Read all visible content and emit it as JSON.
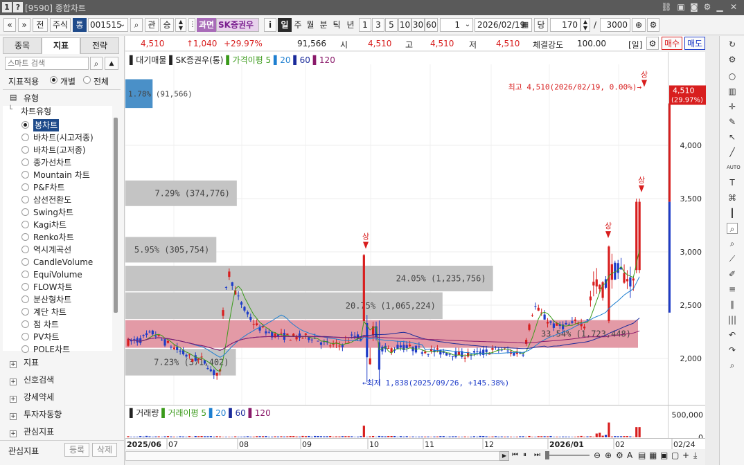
{
  "window": {
    "title": "[9590] 종합차트",
    "win_buttons": [
      "1",
      "?"
    ]
  },
  "toolbar": {
    "nav_prev": "«",
    "nav_down": "»",
    "btn_prev": "전",
    "market": "주식",
    "code_toggle": "통",
    "code": "001515",
    "btn_gwan": "관",
    "btn_sung": "승",
    "badge": "과면",
    "name": "SK증권우",
    "info": "i",
    "periods": [
      "일",
      "주",
      "월",
      "분",
      "틱",
      "년"
    ],
    "active_period": "일",
    "intervals": [
      "1",
      "3",
      "5",
      "10",
      "30",
      "60"
    ],
    "count_field": "1",
    "date": "2026/02/19",
    "btn_dang": "당",
    "view_count": "170",
    "slash": "/",
    "total_count": "3000"
  },
  "left_panel": {
    "tabs": [
      "종목",
      "지표",
      "전략"
    ],
    "active_tab": "지표",
    "search_placeholder": "스마트 검색",
    "apply_label": "지표적용",
    "apply_individual": "개별",
    "apply_all": "전체",
    "section_type": "유형",
    "section_chart_type": "차트유형",
    "chart_types": [
      "봉차트",
      "바차트(시고저종)",
      "바차트(고저종)",
      "종가선차트",
      "Mountain 차트",
      "P&F차트",
      "삼선전환도",
      "Swing차트",
      "Kagi차트",
      "Renko차트",
      "역시계곡선",
      "CandleVolume",
      "EquiVolume",
      "FLOW차트",
      "분산형차트",
      "계단 차트",
      "점 차트",
      "PV차트",
      "POLE차트"
    ],
    "selected_chart_type": "봉차트",
    "groups": [
      "지표",
      "신호검색",
      "강세약세",
      "투자자동향",
      "관심지표"
    ],
    "bottom_label": "관심지표",
    "btn_register": "등록",
    "btn_delete": "삭제"
  },
  "quote_bar": {
    "price": "4,510",
    "change": "↑1,040",
    "change_pct": "+29.97%",
    "volume": "91,566",
    "open_label": "시",
    "open": "4,510",
    "high_label": "고",
    "high": "4,510",
    "low_label": "저",
    "low": "4,510",
    "strength_label": "체결강도",
    "strength": "100.00",
    "period_tag": "[일]",
    "buy_btn": "매수",
    "sell_btn": "매도"
  },
  "legend": {
    "items": [
      {
        "label": "대기매물",
        "color": "#222222"
      },
      {
        "label": "SK증권우(통)",
        "color": "#222222"
      },
      {
        "label": "가격이평 5",
        "color": "#3a9a1a"
      },
      {
        "label": "20",
        "color": "#1e7fd0"
      },
      {
        "label": "60",
        "color": "#1a2a9a"
      },
      {
        "label": "120",
        "color": "#8a1a6a"
      }
    ]
  },
  "colors": {
    "up": "#d81e1e",
    "down": "#1e3cc8",
    "volume_profile": "#c4c4c4",
    "volume_profile_hl": "#e39aa6",
    "volume_profile_top": "#4a90c8"
  },
  "chart_data": {
    "type": "candlestick",
    "title": "SK증권우(통)",
    "y_range": [
      1700,
      4800
    ],
    "y_ticks": [
      "4,000",
      "3,500",
      "3,000",
      "2,500",
      "2,000"
    ],
    "y_tick_values": [
      4000,
      3500,
      3000,
      2500,
      2000
    ],
    "x_labels": [
      "2025/06",
      "07",
      "08",
      "09",
      "10",
      "11",
      "12",
      "2026/01",
      "02",
      "02/24"
    ],
    "current_price_label": "4,510",
    "current_pct_label": "(29.97%)",
    "high_annotation": "최고 4,510(2026/02/19, 0.00%)",
    "low_annotation": "최저 1,838(2025/09/26, +145.38%)",
    "limit_up_marker": "상",
    "volume_profile": [
      {
        "price_low": 4350,
        "price_high": 4620,
        "pct": "1.78%",
        "vol": "(91,566)",
        "share": 1.78
      },
      {
        "price_low": 3430,
        "price_high": 3670,
        "pct": "7.29%",
        "vol": "(374,776)",
        "share": 7.29
      },
      {
        "price_low": 2900,
        "price_high": 3140,
        "pct": "5.95%",
        "vol": "(305,754)",
        "share": 5.95
      },
      {
        "price_low": 2630,
        "price_high": 2870,
        "pct": "24.05%",
        "vol": "(1,235,756)",
        "share": 24.05
      },
      {
        "price_low": 2370,
        "price_high": 2620,
        "pct": "20.75%",
        "vol": "(1,065,224)",
        "share": 20.75
      },
      {
        "price_low": 2100,
        "price_high": 2360,
        "pct": "33.54%",
        "vol": "(1,723,448)",
        "share": 33.54
      },
      {
        "price_low": 1840,
        "price_high": 2090,
        "pct": "7.23%",
        "vol": "(371,402)",
        "share": 7.23
      }
    ],
    "volume": {
      "label": "거래량",
      "ma_label": "거래이평 5",
      "ma20": "20",
      "ma60": "60",
      "ma120": "120",
      "ticks": [
        "500,000",
        "0"
      ],
      "tick_values": [
        500000,
        0
      ],
      "max": 620000
    }
  }
}
